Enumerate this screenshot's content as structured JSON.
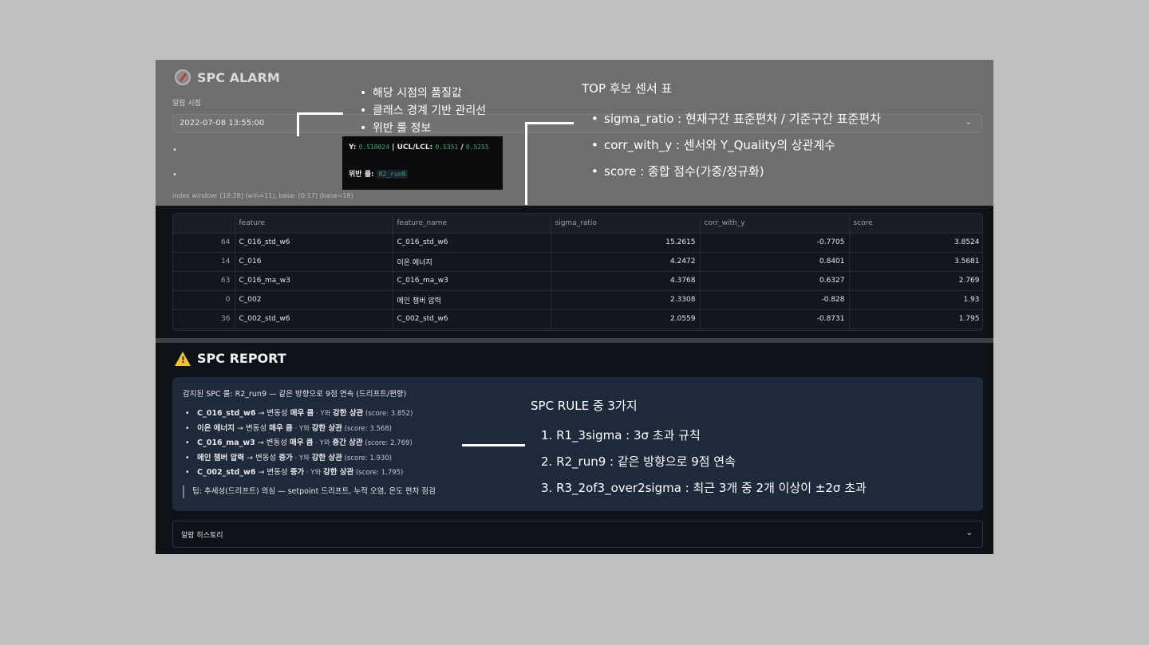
{
  "alarm": {
    "title": "SPC ALARM",
    "time_label": "알람 시점",
    "selected_time": "2022-07-08 13:55:00",
    "metrics": {
      "y_label": "Y:",
      "y_value": "0.518024",
      "ucl_lcl_label": "| UCL/LCL:",
      "ucl_value": "0.5351",
      "sep": "/",
      "lcl_value": "0.5255",
      "violation_label": "위반 룰:",
      "violation_rule": "R2_run9"
    },
    "index_window": "index window: [18:28] (win=11), base: [0:17] (base=18)"
  },
  "annotations": {
    "alarm_points": [
      "해당 시점의 품질값",
      "클래스 경계 기반 관리선",
      "위반 룰 정보"
    ],
    "top_sensor_title": "TOP 후보 센서 표",
    "top_sensor_points": [
      "sigma_ratio : 현재구간 표준편차 / 기준구간 표준편차",
      "corr_with_y : 센서와 Y_Quality의 상관계수",
      "score : 종합 점수(가중/정규화)"
    ],
    "rules_title": "SPC RULE 중 3가지",
    "rules": [
      "1.  R1_3sigma : 3σ 초과 규칙",
      "2.  R2_run9 : 같은 방향으로 9점 연속",
      "3.  R3_2of3_over2sigma : 최근 3개 중 2개 이상이 ±2σ 초과"
    ]
  },
  "table": {
    "headers": [
      "",
      "feature",
      "feature_name",
      "sigma_ratio",
      "corr_with_y",
      "score"
    ],
    "rows": [
      [
        "64",
        "C_016_std_w6",
        "C_016_std_w6",
        "15.2615",
        "-0.7705",
        "3.8524"
      ],
      [
        "14",
        "C_016",
        "이온 에너지",
        "4.2472",
        "0.8401",
        "3.5681"
      ],
      [
        "63",
        "C_016_ma_w3",
        "C_016_ma_w3",
        "4.3768",
        "0.6327",
        "2.769"
      ],
      [
        "0",
        "C_002",
        "메인 챔버 압력",
        "2.3308",
        "-0.828",
        "1.93"
      ],
      [
        "36",
        "C_002_std_w6",
        "C_002_std_w6",
        "2.0559",
        "-0.8731",
        "1.795"
      ]
    ]
  },
  "report": {
    "title": "SPC REPORT",
    "detected": "감지된 SPC 룰: R2_run9 — 같은 방향으로 9점 연속 (드리프트/편향)",
    "items": [
      {
        "name": "C_016_std_w6",
        "arrow": " → 변동성 ",
        "var": "매우 큼",
        "mid": " · Y와 ",
        "corr": "강한 상관",
        "score": " (score: 3.852)"
      },
      {
        "name": "이온 에너지",
        "arrow": " → 변동성 ",
        "var": "매우 큼",
        "mid": " · Y와 ",
        "corr": "강한 상관",
        "score": " (score: 3.568)"
      },
      {
        "name": "C_016_ma_w3",
        "arrow": " → 변동성 ",
        "var": "매우 큼",
        "mid": " · Y와 ",
        "corr": "중간 상관",
        "score": " (score: 2.769)"
      },
      {
        "name": "메인 챔버 압력",
        "arrow": " → 변동성 ",
        "var": "증가",
        "mid": " · Y와 ",
        "corr": "강한 상관",
        "score": " (score: 1.930)"
      },
      {
        "name": "C_002_std_w6",
        "arrow": " → 변동성 ",
        "var": "증가",
        "mid": " · Y와 ",
        "corr": "강한 상관",
        "score": " (score: 1.795)"
      }
    ],
    "tip": "팁: 추세성(드리프트) 의심 — setpoint 드리프트, 누적 오염, 온도 편차 점검",
    "history_label": "알람 히스토리"
  }
}
